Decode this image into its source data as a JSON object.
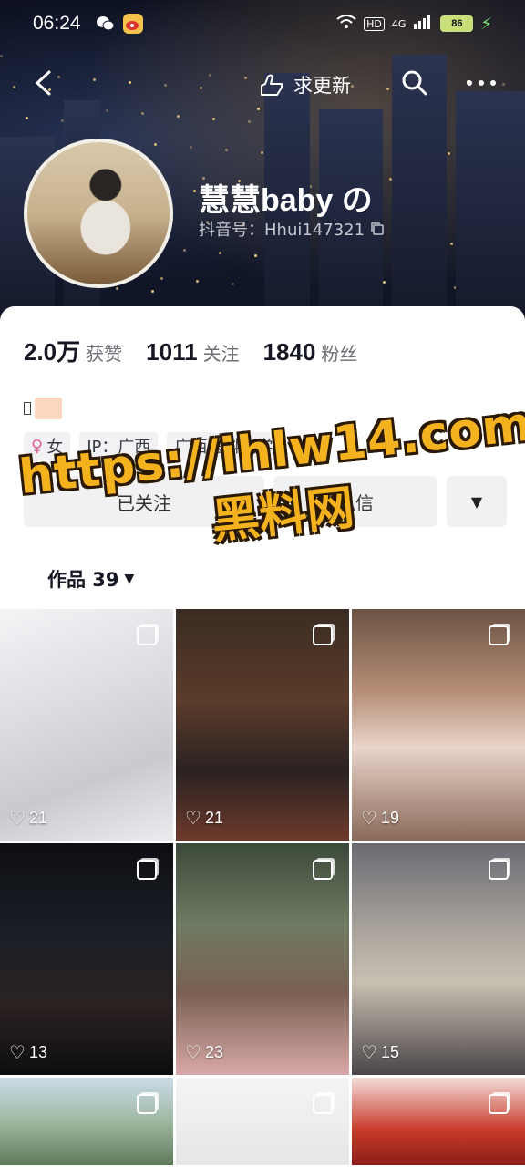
{
  "status_bar": {
    "time": "06:24",
    "network": "4G",
    "hd": "HD",
    "battery": "86"
  },
  "nav": {
    "update_label": "求更新"
  },
  "profile": {
    "name": "慧慧baby の",
    "douyin_id": "抖音号：Hhui147321",
    "stats": [
      {
        "num": "2.0万",
        "label": "获赞"
      },
      {
        "num": "1011",
        "label": "关注"
      },
      {
        "num": "1840",
        "label": "粉丝"
      }
    ],
    "tags": [
      "女",
      "IP：广西",
      "广西医科大学"
    ],
    "followed_label": "已关注",
    "message_label": "私信",
    "works_label": "作品 39"
  },
  "watermark": {
    "line1": "https://ihlw14.com",
    "line2": "黑料网"
  },
  "works": [
    {
      "likes": "21",
      "bg": "linear-gradient(160deg,#f4f4f6 0%,#dcdde2 40%,#c9cacf 70%,#ececef 100%)"
    },
    {
      "likes": "21",
      "bg": "linear-gradient(180deg,#3a2c22 0%,#5b3b2a 40%,#2a2222 70%,#6d3a2a 100%)"
    },
    {
      "likes": "19",
      "bg": "linear-gradient(180deg,#6b5344 0%,#b58d76 35%,#e8d4c8 60%,#8a6a5a 100%)"
    },
    {
      "likes": "13",
      "bg": "linear-gradient(180deg,#0e0f14 0%,#1b1f26 40%,#2b2222 70%,#0d0d10 100%)"
    },
    {
      "likes": "23",
      "bg": "linear-gradient(180deg,#3c4a3a 0%,#6f7a62 35%,#7a6052 65%,#d9a9a8 100%)"
    },
    {
      "likes": "15",
      "bg": "linear-gradient(180deg,#6a6a72 0%,#a6a09a 35%,#c8c0b2 60%,#4a4448 100%)"
    },
    {
      "likes": "",
      "bg": "linear-gradient(180deg,#c9dbe8 0%,#9fb8a1 50%,#5f7a5a 100%)"
    },
    {
      "likes": "",
      "bg": "linear-gradient(180deg,#f4f4f4 0%,#e6e6e6 100%)"
    },
    {
      "likes": "",
      "bg": "linear-gradient(180deg,#f3dcd8 0%,#c83a2a 60%,#8a1e18 100%)"
    }
  ],
  "colors": {
    "accent": "#f5b21f",
    "female": "#e0608f"
  }
}
